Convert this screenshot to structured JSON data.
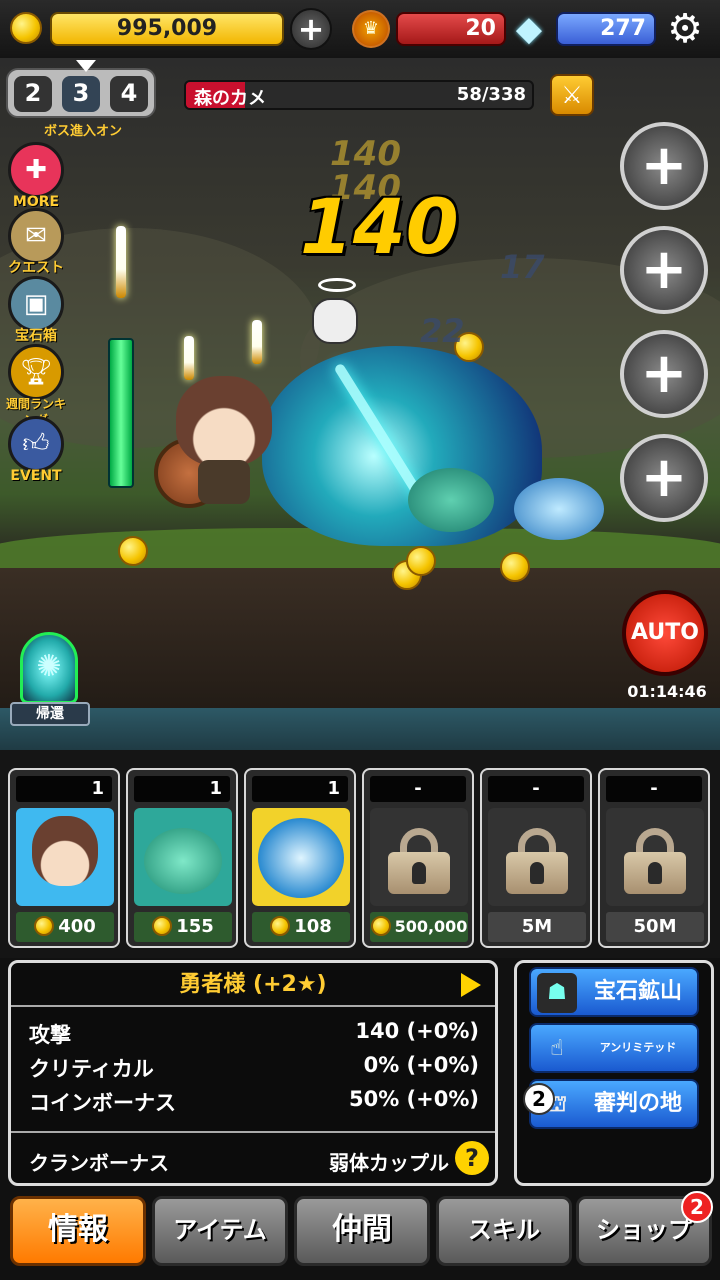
{
  "resources": {
    "gold": "995,009",
    "crowns": "20",
    "gems": "277"
  },
  "stage": {
    "levels": [
      "2",
      "3",
      "4"
    ],
    "current": "3",
    "boss_label": "ボス進入オン"
  },
  "enemy": {
    "name": "森のカメ",
    "hp_text": "58/338",
    "hp_fraction": 0.17
  },
  "side_menu": [
    {
      "label": "MORE",
      "icon": "more-icon"
    },
    {
      "label": "クエスト",
      "icon": "quest-scroll-icon"
    },
    {
      "label": "宝石箱",
      "icon": "treasure-chest-icon"
    },
    {
      "label": "週間ランキング",
      "icon": "trophy-icon"
    },
    {
      "label": "EVENT",
      "icon": "thumbs-up-icon"
    }
  ],
  "damage": {
    "main": "140",
    "faded1": "140",
    "faded2": "140",
    "blue": "22",
    "blue2": "17"
  },
  "auto": {
    "label": "AUTO",
    "timer": "01:14:46"
  },
  "return_label": "帰還",
  "heroes": [
    {
      "level": "1",
      "cost": "400",
      "locked": false,
      "portrait": "hero-boy"
    },
    {
      "level": "1",
      "cost": "155",
      "locked": false,
      "portrait": "green-dino"
    },
    {
      "level": "1",
      "cost": "108",
      "locked": false,
      "portrait": "blue-whale"
    },
    {
      "level": "-",
      "cost": "500,000",
      "locked": true
    },
    {
      "level": "-",
      "cost": "5M",
      "locked": true
    },
    {
      "level": "-",
      "cost": "50M",
      "locked": true
    }
  ],
  "info": {
    "title": "勇者様 (+2★)",
    "stats": [
      {
        "label": "攻撃",
        "value": "140 (+0%)"
      },
      {
        "label": "クリティカル",
        "value": "0% (+0%)"
      },
      {
        "label": "コインボーナス",
        "value": "50% (+0%)"
      }
    ],
    "clan_label": "クランボーナス",
    "clan_value": "弱体カップル",
    "help": "?"
  },
  "shortcuts": [
    {
      "label": "宝石鉱山",
      "icon": "mine-icon",
      "badge": ""
    },
    {
      "label": "アンリミテッド",
      "icon": "tap-hand-icon",
      "badge": ""
    },
    {
      "label": "審判の地",
      "icon": "colosseum-icon",
      "badge": "2"
    }
  ],
  "tabs": [
    {
      "label": "情報",
      "active": true,
      "badge": ""
    },
    {
      "label": "アイテム",
      "active": false,
      "badge": ""
    },
    {
      "label": "仲間",
      "active": false,
      "badge": ""
    },
    {
      "label": "スキル",
      "active": false,
      "badge": ""
    },
    {
      "label": "ショップ",
      "active": false,
      "badge": "2"
    }
  ],
  "colors": {
    "gold": "#f2b600",
    "crown_bar": "#c8102e",
    "gem_bar": "#3a5fd6",
    "active_tab": "#ff8a00",
    "title_yellow": "#ffcc33"
  }
}
